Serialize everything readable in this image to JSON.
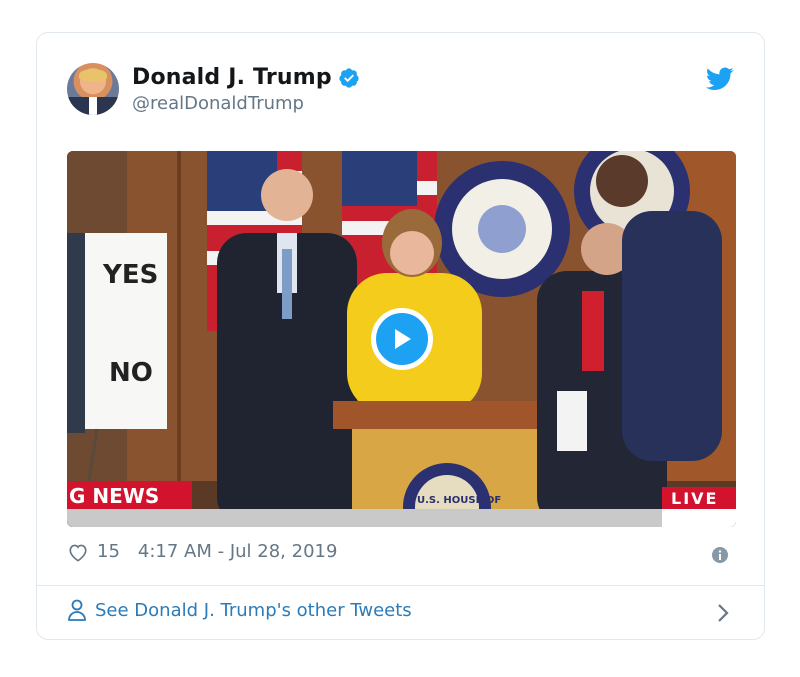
{
  "tweet": {
    "author": {
      "display_name": "Donald J. Trump",
      "handle": "@realDonaldTrump",
      "verified": true
    },
    "likes": "15",
    "timestamp": "4:17 AM - Jul 28, 2019"
  },
  "video": {
    "sign_top": "YES",
    "sign_bottom": "NO",
    "banner_left": "G NEWS",
    "banner_right": "LIVE",
    "seal_text": "U.S. HOUSE OF"
  },
  "footer": {
    "other_tweets_label": "See Donald J. Trump's other Tweets"
  },
  "colors": {
    "accent": "#1da1f2",
    "link": "#2b7bb9",
    "muted": "#657786",
    "banner_red": "#d3132e"
  }
}
